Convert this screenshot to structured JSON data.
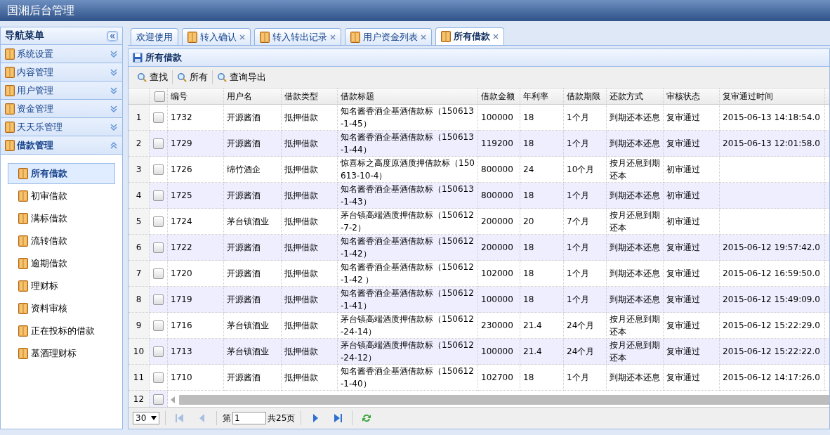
{
  "window": {
    "title": "国湘后台管理"
  },
  "sidebar": {
    "title": "导航菜单",
    "sections": [
      {
        "label": "系统设置",
        "expanded": false
      },
      {
        "label": "内容管理",
        "expanded": false
      },
      {
        "label": "用户管理",
        "expanded": false
      },
      {
        "label": "资金管理",
        "expanded": false
      },
      {
        "label": "天天乐管理",
        "expanded": false
      },
      {
        "label": "借款管理",
        "expanded": true,
        "items": [
          {
            "label": "所有借款",
            "selected": true
          },
          {
            "label": "初审借款",
            "selected": false
          },
          {
            "label": "满标借款",
            "selected": false
          },
          {
            "label": "流转借款",
            "selected": false
          },
          {
            "label": "逾期借款",
            "selected": false
          },
          {
            "label": "理财标",
            "selected": false
          },
          {
            "label": "资料审核",
            "selected": false
          },
          {
            "label": "正在投标的借款",
            "selected": false
          },
          {
            "label": "基酒理财标",
            "selected": false
          }
        ]
      }
    ]
  },
  "tabs": [
    {
      "label": "欢迎使用",
      "selected": false,
      "closable": false
    },
    {
      "label": "转入确认",
      "selected": false,
      "closable": true
    },
    {
      "label": "转入转出记录",
      "selected": false,
      "closable": true
    },
    {
      "label": "用户资金列表",
      "selected": false,
      "closable": true
    },
    {
      "label": "所有借款",
      "selected": true,
      "closable": true
    }
  ],
  "panel": {
    "title": "所有借款",
    "toolbar": [
      "查找",
      "所有",
      "查询导出"
    ]
  },
  "table": {
    "select_all_checked": false,
    "columns": [
      "编号",
      "用户名",
      "借款类型",
      "借款标题",
      "借款金额",
      "年利率",
      "借款期限",
      "还款方式",
      "审核状态",
      "复审通过时间"
    ],
    "rows": [
      {
        "index": "1",
        "checked": false,
        "cells": [
          "1732",
          "开源酱酒",
          "抵押借款",
          "知名酱香酒企基酒借款标（150613-1-45）",
          "100000",
          "18",
          "1个月",
          "到期还本还息",
          "复审通过",
          "2015-06-13 14:18:54.0"
        ]
      },
      {
        "index": "2",
        "checked": false,
        "cells": [
          "1729",
          "开源酱酒",
          "抵押借款",
          "知名酱香酒企基酒借款标（150613-1-44）",
          "119200",
          "18",
          "1个月",
          "到期还本还息",
          "复审通过",
          "2015-06-13 12:01:58.0"
        ]
      },
      {
        "index": "3",
        "checked": false,
        "cells": [
          "1726",
          "绵竹酒企",
          "抵押借款",
          "惊喜标之高度原酒质押借款标（150613-10-4）",
          "800000",
          "24",
          "10个月",
          "按月还息到期还本",
          "初审通过"
        ]
      },
      {
        "index": "4",
        "checked": false,
        "cells": [
          "1725",
          "开源酱酒",
          "抵押借款",
          "知名酱香酒企基酒借款标（150613-1-43）",
          "800000",
          "18",
          "1个月",
          "到期还本还息",
          "初审通过"
        ]
      },
      {
        "index": "5",
        "checked": false,
        "cells": [
          "1724",
          "茅台镇酒业",
          "抵押借款",
          "茅台镇高端酒质押借款标（150612-7-2）",
          "200000",
          "20",
          "7个月",
          "按月还息到期还本",
          "初审通过"
        ]
      },
      {
        "index": "6",
        "checked": false,
        "cells": [
          "1722",
          "开源酱酒",
          "抵押借款",
          "知名酱香酒企基酒借款标（150612-1-42）",
          "200000",
          "18",
          "1个月",
          "到期还本还息",
          "复审通过",
          "2015-06-12 19:57:42.0"
        ]
      },
      {
        "index": "7",
        "checked": false,
        "cells": [
          "1720",
          "开源酱酒",
          "抵押借款",
          "知名酱香酒企基酒借款标（150612-1-42 ）",
          "102000",
          "18",
          "1个月",
          "到期还本还息",
          "复审通过",
          "2015-06-12 16:59:50.0"
        ]
      },
      {
        "index": "8",
        "checked": false,
        "cells": [
          "1719",
          "开源酱酒",
          "抵押借款",
          "知名酱香酒企基酒借款标（150612-1-41）",
          "100000",
          "18",
          "1个月",
          "到期还本还息",
          "复审通过",
          "2015-06-12 15:49:09.0"
        ]
      },
      {
        "index": "9",
        "checked": false,
        "cells": [
          "1716",
          "茅台镇酒业",
          "抵押借款",
          "茅台镇高端酒质押借款标（150612-24-14）",
          "230000",
          "21.4",
          "24个月",
          "按月还息到期还本",
          "复审通过",
          "2015-06-12 15:22:29.0"
        ]
      },
      {
        "index": "10",
        "checked": false,
        "cells": [
          "1713",
          "茅台镇酒业",
          "抵押借款",
          "茅台镇高端酒质押借款标（150612-24-12）",
          "100000",
          "21.4",
          "24个月",
          "按月还息到期还本",
          "复审通过",
          "2015-06-12 15:22:22.0"
        ]
      },
      {
        "index": "11",
        "checked": false,
        "cells": [
          "1710",
          "开源酱酒",
          "抵押借款",
          "知名酱香酒企基酒借款标（150612-1-40）",
          "102700",
          "18",
          "1个月",
          "到期还本还息",
          "复审通过",
          "2015-06-12 14:17:26.0"
        ]
      },
      {
        "index": "12",
        "checked": false
      }
    ]
  },
  "pager": {
    "page_size": "30",
    "page_label": "第",
    "page": "1",
    "total": "共25页"
  }
}
